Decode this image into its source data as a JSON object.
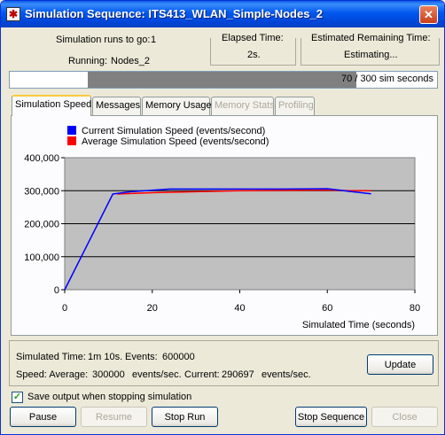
{
  "window": {
    "title": "Simulation Sequence: ITS413_WLAN_Simple-Nodes_2",
    "close_glyph": "✕"
  },
  "status": {
    "runs_to_go_label": "Simulation runs to go:",
    "runs_to_go_value": "1",
    "running_label": "Running:",
    "running_value": "Nodes_2",
    "elapsed_title": "Elapsed Time:",
    "elapsed_value": "2s.",
    "remaining_title": "Estimated Remaining Time:",
    "remaining_value": "Estimating..."
  },
  "progress": {
    "label": "70 / 300 sim seconds",
    "fraction": 0.8167
  },
  "tabs": [
    {
      "label": "Simulation Speed",
      "active": true,
      "enabled": true
    },
    {
      "label": "Messages",
      "active": false,
      "enabled": true
    },
    {
      "label": "Memory Usage",
      "active": false,
      "enabled": true
    },
    {
      "label": "Memory Stats",
      "active": false,
      "enabled": false
    },
    {
      "label": "Profiling",
      "active": false,
      "enabled": false
    }
  ],
  "chart_data": {
    "type": "line",
    "xlabel": "Simulated Time (seconds)",
    "ylabel": "",
    "xlim": [
      0,
      80
    ],
    "ylim": [
      0,
      400000
    ],
    "x_ticks": [
      0,
      20,
      40,
      60,
      80
    ],
    "y_ticks": [
      0,
      100000,
      200000,
      300000,
      400000
    ],
    "y_tick_labels": [
      "0",
      "100,000",
      "200,000",
      "300,000",
      "400,000"
    ],
    "grid": "horizontal",
    "legend_position": "top-left",
    "series": [
      {
        "name": "Current Simulation Speed (events/second)",
        "color": "#0000ff",
        "x": [
          0,
          11,
          15,
          24,
          30,
          40,
          50,
          60,
          65,
          70
        ],
        "y": [
          0,
          290000,
          297000,
          305000,
          305000,
          305000,
          305000,
          306000,
          298000,
          290697
        ]
      },
      {
        "name": "Average Simulation Speed (events/second)",
        "color": "#ff0000",
        "x": [
          12,
          20,
          30,
          40,
          50,
          60,
          65,
          70
        ],
        "y": [
          290000,
          294000,
          297000,
          300000,
          301000,
          302000,
          300000,
          300000
        ]
      }
    ]
  },
  "summary": {
    "sim_time_label": "Simulated Time:",
    "sim_time_value": "1m 10s.",
    "events_label": "Events:",
    "events_value": "600000",
    "speed_avg_label": "Speed: Average:",
    "speed_avg_value": "300000",
    "speed_avg_unit": "events/sec.",
    "speed_cur_label": "Current:",
    "speed_cur_value": "290697",
    "speed_cur_unit": "events/sec."
  },
  "buttons": {
    "update": "Update",
    "pause": "Pause",
    "resume": "Resume",
    "stop_run": "Stop Run",
    "stop_sequence": "Stop Sequence",
    "close": "Close"
  },
  "options": {
    "save_output_label": "Save output when stopping simulation",
    "save_output_checked": true
  }
}
